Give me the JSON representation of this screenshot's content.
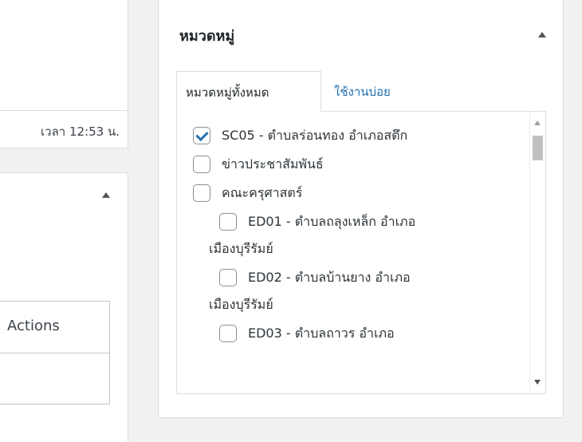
{
  "left": {
    "time_text": "เวลา 12:53 น.",
    "actions_header": "Actions"
  },
  "categories": {
    "title": "หมวดหมู่",
    "tabs": {
      "all": "หมวดหมู่ทั้งหมด",
      "popular": "ใช้งานบ่อย"
    },
    "items": [
      {
        "label": "SC05 - ตำบลร่อนทอง อำเภอสตึก",
        "checked": true
      },
      {
        "label": "ข่าวประชาสัมพันธ์",
        "checked": false
      },
      {
        "label": "คณะครุศาสตร์",
        "checked": false
      },
      {
        "label": "ED01 - ตำบลถลุงเหล็ก อำเภอ",
        "continuation": "เมืองบุรีรัมย์",
        "checked": false
      },
      {
        "label": "ED02 - ตำบลบ้านยาง อำเภอ",
        "continuation": "เมืองบุรีรัมย์",
        "checked": false
      },
      {
        "label": "ED03 - ตำบลถาวร อำเภอ",
        "checked": false
      }
    ]
  }
}
